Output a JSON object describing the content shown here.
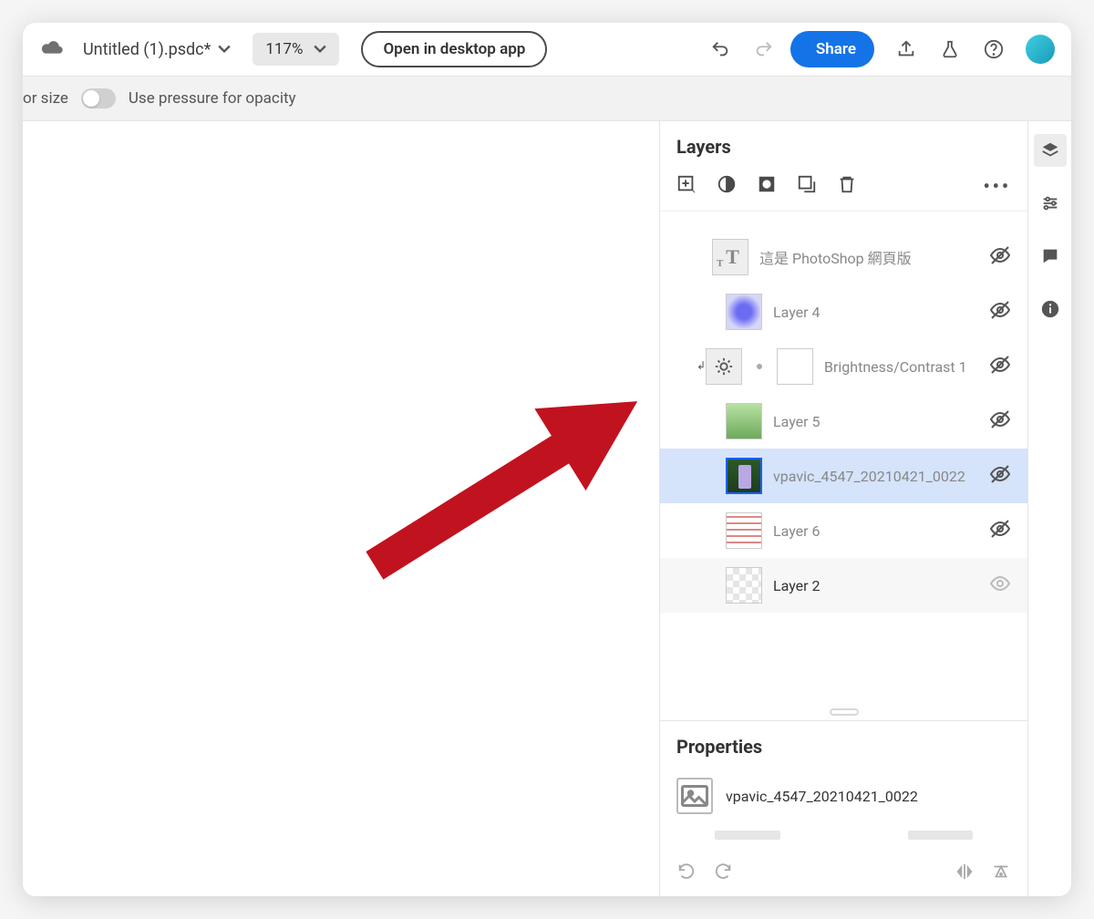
{
  "topbar": {
    "file_name": "Untitled (1).psdc*",
    "zoom": "117%",
    "open_desktop": "Open in desktop app",
    "share": "Share"
  },
  "optionsbar": {
    "cutoff_label": "or size",
    "pressure_opacity": "Use pressure for opacity"
  },
  "layers_panel": {
    "title": "Layers",
    "layers": [
      {
        "name": "這是 PhotoShop 網頁版",
        "visible": false,
        "kind": "text"
      },
      {
        "name": "Layer 4",
        "visible": false,
        "kind": "pixel"
      },
      {
        "name": "Brightness/Contrast 1",
        "visible": false,
        "kind": "adjustment"
      },
      {
        "name": "Layer 5",
        "visible": false,
        "kind": "pixel"
      },
      {
        "name": "vpavic_4547_20210421_0022",
        "visible": false,
        "kind": "pixel",
        "selected": true
      },
      {
        "name": "Layer 6",
        "visible": false,
        "kind": "pixel"
      },
      {
        "name": "Layer 2",
        "visible": true,
        "kind": "pixel"
      }
    ]
  },
  "properties_panel": {
    "title": "Properties",
    "layer_name": "vpavic_4547_20210421_0022"
  },
  "colors": {
    "accent": "#1473e6",
    "selection": "#d5e3fb",
    "arrow": "#c1121f"
  }
}
